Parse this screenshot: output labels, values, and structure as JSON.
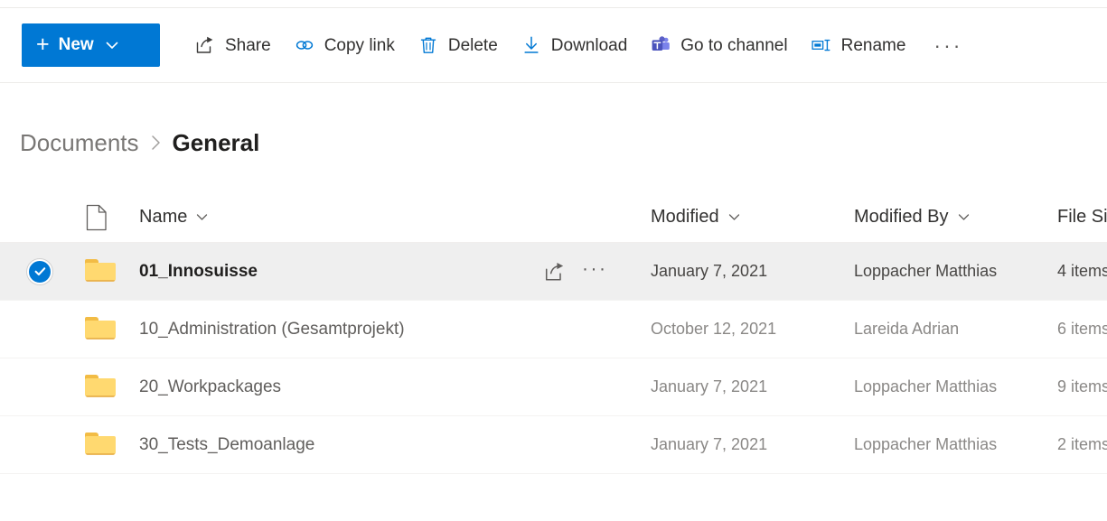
{
  "toolbar": {
    "new_label": "New",
    "items": [
      {
        "label": "Share",
        "icon": "share-icon"
      },
      {
        "label": "Copy link",
        "icon": "link-icon"
      },
      {
        "label": "Delete",
        "icon": "trash-icon"
      },
      {
        "label": "Download",
        "icon": "download-icon"
      },
      {
        "label": "Go to channel",
        "icon": "teams-icon"
      },
      {
        "label": "Rename",
        "icon": "rename-icon"
      }
    ],
    "overflow_label": "···"
  },
  "breadcrumb": {
    "root": "Documents",
    "separator": "›",
    "current": "General"
  },
  "columns": {
    "name": "Name",
    "modified": "Modified",
    "modified_by": "Modified By",
    "file_size": "File Size"
  },
  "rows": [
    {
      "name": "01_Innosuisse",
      "modified": "January 7, 2021",
      "modified_by": "Loppacher Matthias",
      "size": "4 items",
      "selected": true
    },
    {
      "name": "10_Administration (Gesamtprojekt)",
      "modified": "October 12, 2021",
      "modified_by": "Lareida Adrian",
      "size": "6 items",
      "selected": false
    },
    {
      "name": "20_Workpackages",
      "modified": "January 7, 2021",
      "modified_by": "Loppacher Matthias",
      "size": "9 items",
      "selected": false
    },
    {
      "name": "30_Tests_Demoanlage",
      "modified": "January 7, 2021",
      "modified_by": "Loppacher Matthias",
      "size": "2 items",
      "selected": false
    }
  ],
  "row_actions": {
    "share": "share-icon",
    "more": "···"
  },
  "colors": {
    "accent": "#0078d4",
    "folder": "#ffd970",
    "teams": "#5b5fc7",
    "selected_row": "#efefef"
  }
}
